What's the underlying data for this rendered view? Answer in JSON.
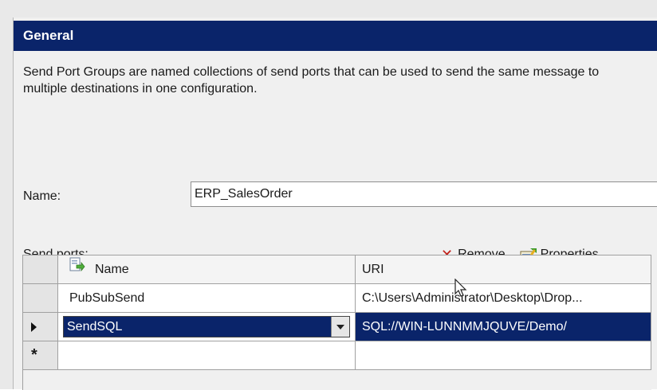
{
  "header": {
    "title": "General"
  },
  "description": "Send Port Groups are named collections of send ports that can be used to send the same message to multiple destinations in one configuration.",
  "name_field": {
    "label": "Name:",
    "value": "ERP_SalesOrder"
  },
  "send_ports": {
    "label": "Send ports:",
    "toolbar": {
      "remove_label": "Remove",
      "remove_icon": "remove-x-icon",
      "properties_label": "Properties...",
      "properties_icon": "properties-icon"
    },
    "columns": {
      "name": "Name",
      "uri": "URI"
    },
    "rows": [
      {
        "name": "PubSubSend",
        "uri": "C:\\Users\\Administrator\\Desktop\\Drop..."
      },
      {
        "name": "SendSQL",
        "uri": "SQL://WIN-LUNNMMJQUVE/Demo/",
        "selected": true
      }
    ],
    "new_row_marker": "*"
  },
  "colors": {
    "header_bg": "#0a246a",
    "selection_bg": "#0a246a",
    "remove_icon": "#c0201a"
  }
}
